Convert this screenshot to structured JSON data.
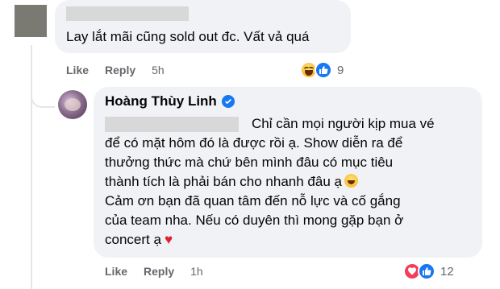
{
  "top_comment": {
    "text": "Lay lắt mãi cũng sold out đc. Vất vả quá",
    "actions": {
      "like": "Like",
      "reply": "Reply",
      "time": "5h"
    },
    "reactions": {
      "icons": [
        "haha-icon",
        "like-icon"
      ],
      "count": "9"
    }
  },
  "reply_comment": {
    "author": "Hoàng Thùy Linh",
    "verified": true,
    "lines": [
      "Chỉ cần mọi người kịp mua vé",
      "để có mặt hôm đó là được rồi ạ. Show diễn ra để",
      "thưởng thức mà chứ bên mình đâu có mục tiêu",
      "thành tích là phải bán cho nhanh đâu ạ",
      "Cảm ơn bạn đã quan tâm đến nỗ lực và cố gắng",
      "của team nha. Nếu có duyên thì mong gặp bạn ở",
      "concert ạ"
    ],
    "actions": {
      "like": "Like",
      "reply": "Reply",
      "time": "1h"
    },
    "reactions": {
      "icons": [
        "love-icon",
        "like-icon"
      ],
      "count": "12"
    }
  },
  "colors": {
    "bubble": "#f0f2f5",
    "secondary_text": "#65676b",
    "like_blue": "#1877f2",
    "love_red": "#f33e58"
  }
}
